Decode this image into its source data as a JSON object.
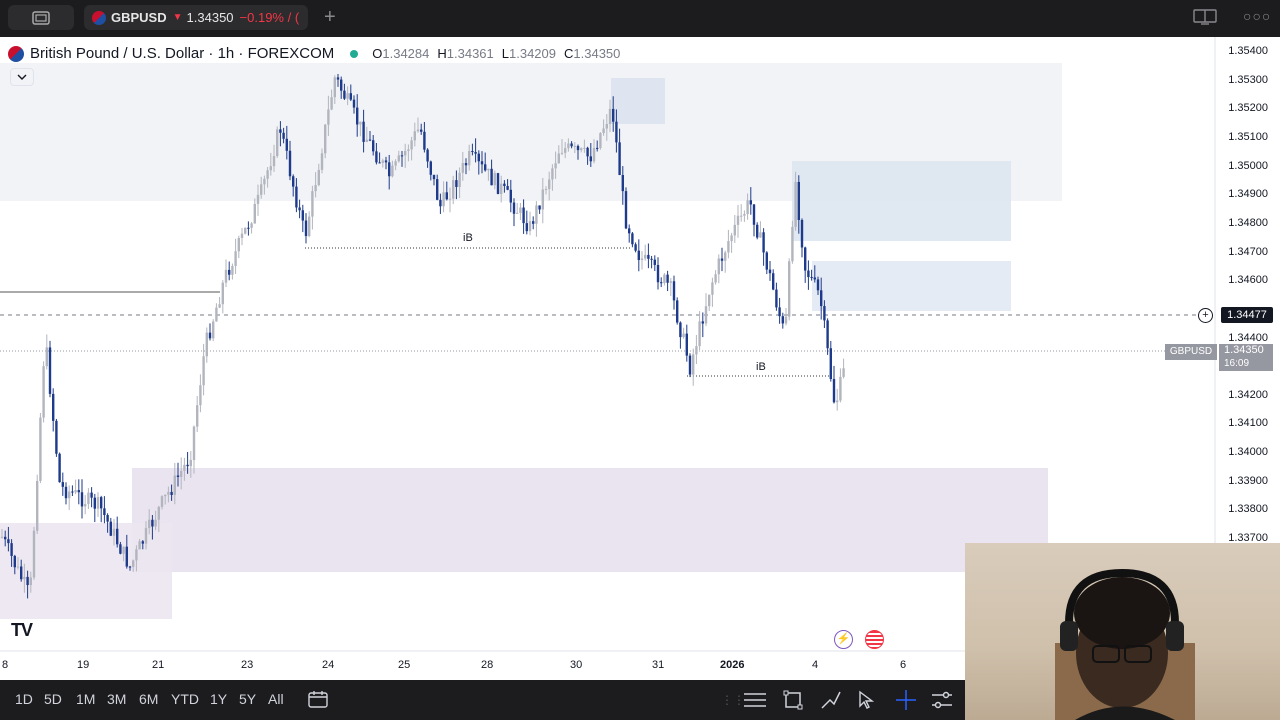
{
  "tab": {
    "symbol": "GBPUSD",
    "price": "1.34350",
    "change": "−0.19% / (",
    "add_tab": "+"
  },
  "header": {
    "title": "British Pound / U.S. Dollar · 1h · FOREXCOM",
    "o_label": "O",
    "o_value": "1.34284",
    "h_label": "H",
    "h_value": "1.34361",
    "l_label": "L",
    "l_value": "1.34209",
    "c_label": "C",
    "c_value": "1.34350",
    "status_color": "#22ab94"
  },
  "price_axis": [
    "1.35400",
    "1.35300",
    "1.35200",
    "1.35100",
    "1.35000",
    "1.34900",
    "1.34800",
    "1.34700",
    "1.34600",
    "1.34400",
    "1.34200",
    "1.34100",
    "1.34000",
    "1.33900",
    "1.33800",
    "1.33700"
  ],
  "crosshair_price": "1.34477",
  "last_price": {
    "symbol": "GBPUSD",
    "price": "1.34350",
    "countdown": "16:09"
  },
  "date_axis": [
    "8",
    "19",
    "21",
    "23",
    "24",
    "25",
    "28",
    "30",
    "31",
    "2026",
    "4",
    "6"
  ],
  "annotations": {
    "ib1": "iB",
    "ib2": "iB"
  },
  "ranges": [
    "1D",
    "5D",
    "1M",
    "3M",
    "6M",
    "YTD",
    "1Y",
    "5Y",
    "All"
  ],
  "logo": "TV",
  "colors": {
    "up": "#b2b5be",
    "down": "#1e3a8a",
    "accent": "#2962ff",
    "negative": "#f23645"
  },
  "icons": [
    "layout-icon",
    "more-icon",
    "calendar-icon",
    "lines-icon",
    "rect-icon",
    "path-icon",
    "cursor-icon",
    "crosshair-icon",
    "settings-icon"
  ]
}
